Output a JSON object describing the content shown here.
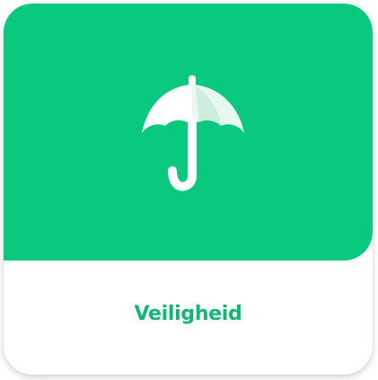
{
  "card": {
    "label": "Veiligheid",
    "icon": "umbrella-icon",
    "accent_color": "#09c97f",
    "label_color": "#12b872"
  }
}
